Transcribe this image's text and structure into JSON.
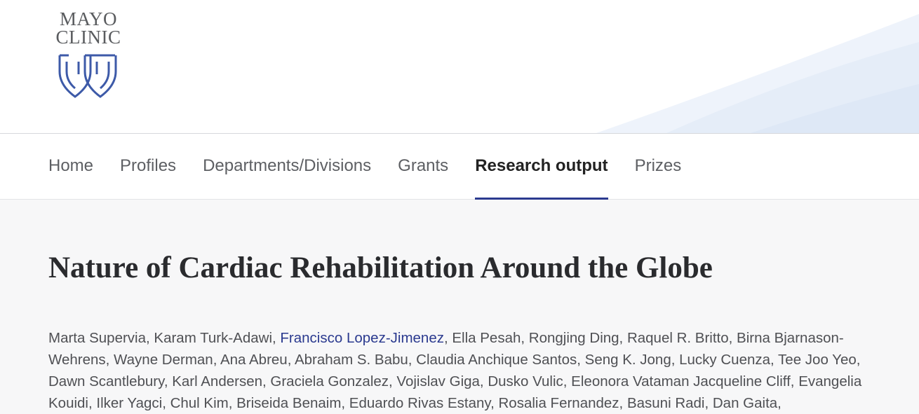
{
  "logo": {
    "line1": "MAYO",
    "line2": "CLINIC",
    "icon": "mayo-shields-icon",
    "color": "#5a5c5f",
    "shield_color": "#3d5aa8"
  },
  "nav": {
    "items": [
      {
        "label": "Home"
      },
      {
        "label": "Profiles"
      },
      {
        "label": "Departments/Divisions"
      },
      {
        "label": "Grants"
      },
      {
        "label": "Research output",
        "active": true
      },
      {
        "label": "Prizes"
      }
    ],
    "active_color": "#2b3a8f"
  },
  "publication": {
    "title": "Nature of Cardiac Rehabilitation Around the Globe",
    "authors": {
      "lead": "Marta Supervia, Karam Turk-Adawi, ",
      "linked": "Francisco Lopez-Jimenez",
      "rest": ", Ella Pesah, Rongjing Ding, Raquel R. Britto, Birna Bjarnason-Wehrens, Wayne Derman, Ana Abreu, Abraham S. Babu, Claudia Anchique Santos, Seng K. Jong, Lucky Cuenza, Tee Joo Yeo, Dawn Scantlebury, Karl Andersen, Graciela Gonzalez, Vojislav Giga, Dusko Vulic, Eleonora Vataman  Jacqueline Cliff, Evangelia Kouidi, Ilker Yagci, Chul Kim, Briseida Benaim, Eduardo Rivas Estany, Rosalia Fernandez, Basuni Radi, Dan Gaita,"
    }
  }
}
